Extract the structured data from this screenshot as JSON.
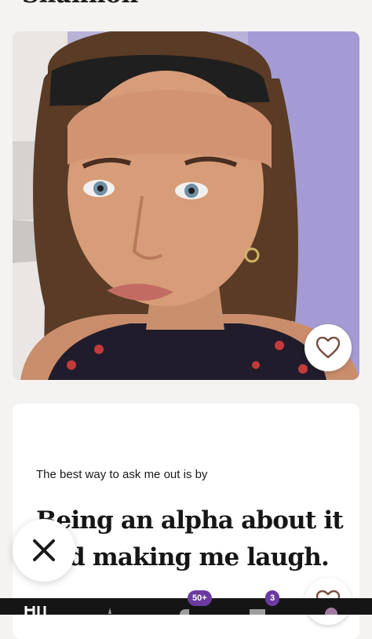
{
  "profile": {
    "name": "Shannon"
  },
  "photo": {
    "alt": "profile photo",
    "like_icon": "heart-icon"
  },
  "prompt": {
    "question": "The best way to ask me out is by",
    "answer": "Being an alpha about it and making me laugh."
  },
  "actions": {
    "skip_icon": "close-icon",
    "like_icon": "heart-icon"
  },
  "nav": {
    "items": [
      {
        "name": "home",
        "icon": "logo-icon"
      },
      {
        "name": "standouts",
        "icon": "star-icon"
      },
      {
        "name": "likes-you",
        "icon": "likes-icon",
        "badge": "50+"
      },
      {
        "name": "matches",
        "icon": "chat-icon",
        "badge": "3"
      },
      {
        "name": "profile",
        "icon": "avatar-icon"
      }
    ]
  },
  "colors": {
    "badge": "#6b3aa0",
    "nav_bg": "#151515",
    "heart": "#7a4e42"
  }
}
